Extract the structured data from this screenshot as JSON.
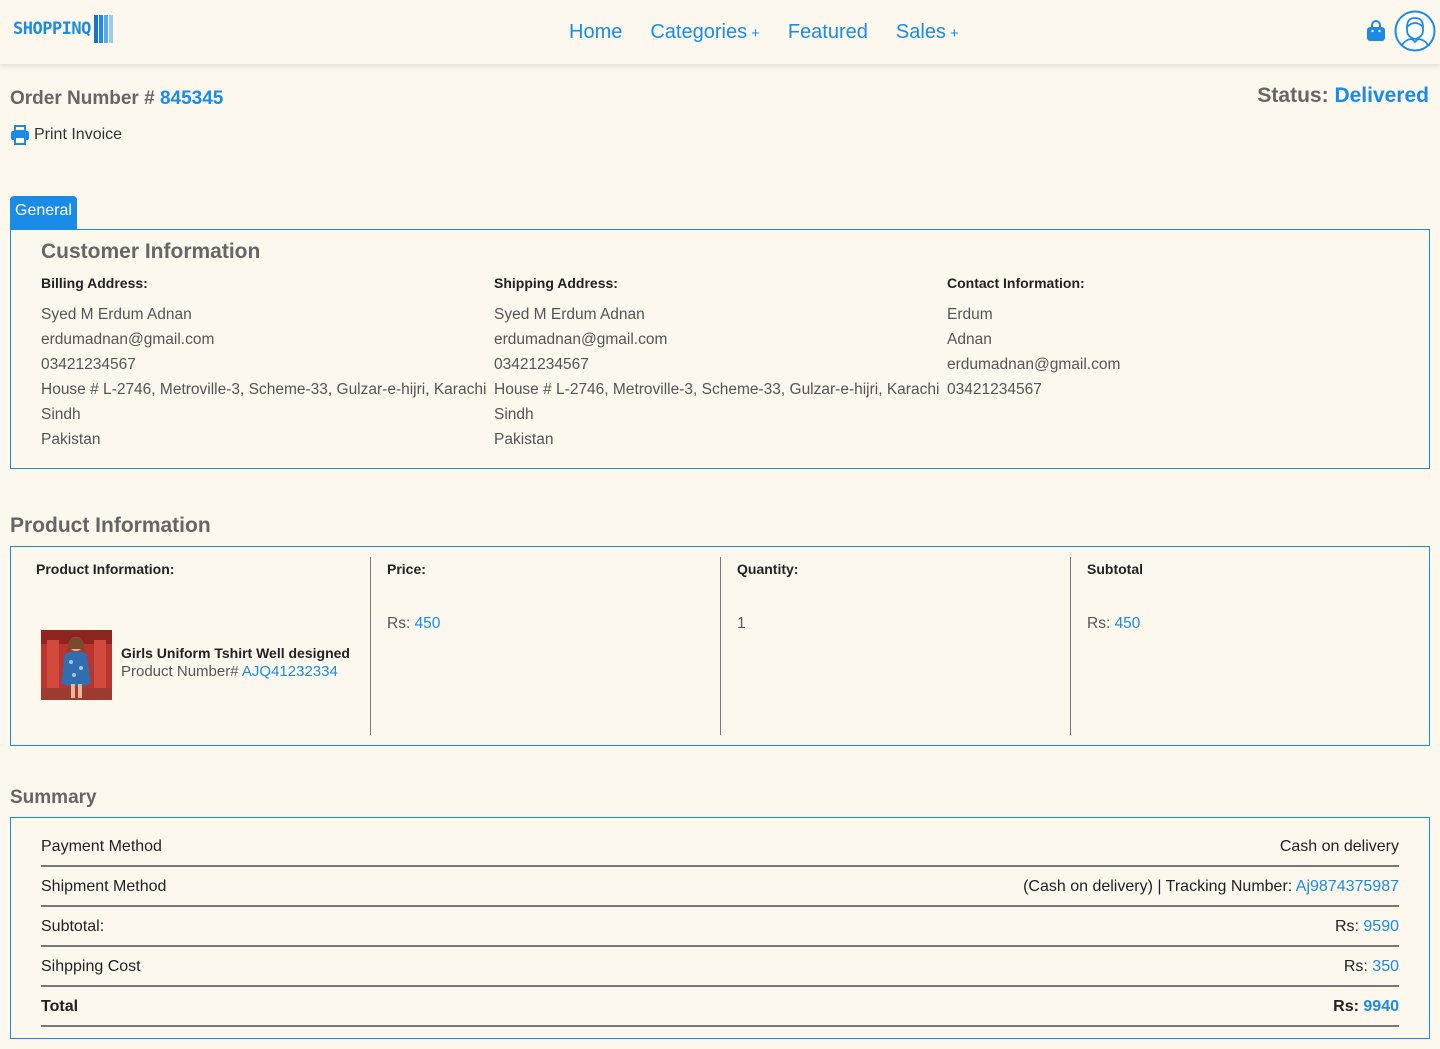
{
  "header": {
    "logo_text": "SHOPPINQ",
    "nav": [
      {
        "label": "Home",
        "has_plus": false
      },
      {
        "label": "Categories",
        "has_plus": true
      },
      {
        "label": "Featured",
        "has_plus": false
      },
      {
        "label": "Sales",
        "has_plus": true
      }
    ],
    "plus_symbol": "+",
    "icons": {
      "cart": "shopping-bag-icon",
      "user": "user-avatar-icon"
    }
  },
  "order": {
    "number_label": "Order Number #",
    "number": "845345",
    "status_label": "Status:",
    "status": "Delivered",
    "print_label": "Print Invoice"
  },
  "tabs": {
    "general": "General"
  },
  "customer": {
    "title": "Customer Information",
    "billing": {
      "heading": "Billing Address:",
      "lines": [
        "Syed M Erdum Adnan",
        "erdumadnan@gmail.com",
        "03421234567",
        "House # L-2746, Metroville-3, Scheme-33, Gulzar-e-hijri, Karachi",
        "Sindh",
        "Pakistan"
      ]
    },
    "shipping": {
      "heading": "Shipping Address:",
      "lines": [
        "Syed M Erdum Adnan",
        "erdumadnan@gmail.com",
        "03421234567",
        "House # L-2746, Metroville-3, Scheme-33, Gulzar-e-hijri, Karachi",
        "Sindh",
        "Pakistan"
      ]
    },
    "contact": {
      "heading": "Contact Information:",
      "lines": [
        "Erdum",
        "Adnan",
        "erdumadnan@gmail.com",
        "03421234567"
      ]
    }
  },
  "product": {
    "title": "Product Information",
    "headers": {
      "info": "Product Information:",
      "price": "Price:",
      "quantity": "Quantity:",
      "subtotal": "Subtotal"
    },
    "name": "Girls Uniform Tshirt Well designed",
    "number_label": "Product Number#",
    "number": "AJQ41232334",
    "currency": "Rs:",
    "price": "450",
    "quantity": "1",
    "subtotal": "450"
  },
  "summary": {
    "title": "Summary",
    "payment_label": "Payment Method",
    "payment_value": "Cash on delivery",
    "shipment_label": "Shipment Method",
    "shipment_value": "(Cash on delivery) | Tracking Number:",
    "tracking_number": "Aj9874375987",
    "subtotal_label": "Subtotal:",
    "subtotal": "9590",
    "shipping_label": "Sihpping Cost",
    "shipping": "350",
    "total_label": "Total",
    "total": "9940",
    "currency": "Rs:"
  },
  "colors": {
    "accent": "#1a8be6",
    "background": "#fdf8ee"
  }
}
